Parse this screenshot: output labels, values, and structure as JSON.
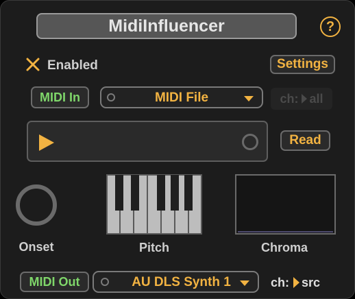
{
  "app": {
    "title": "MidiInfluencer",
    "help_label": "?"
  },
  "enabled": {
    "label": "Enabled"
  },
  "settings_label": "Settings",
  "midi_in": {
    "button_label": "MIDI In",
    "source": "MIDI File",
    "channel_label": "ch:",
    "channel_value": "all"
  },
  "player": {
    "read_label": "Read"
  },
  "analysis": {
    "onset_label": "Onset",
    "pitch_label": "Pitch",
    "chroma_label": "Chroma"
  },
  "midi_out": {
    "button_label": "MIDI Out",
    "destination": "AU DLS Synth 1",
    "channel_label": "ch:",
    "channel_value": "src"
  },
  "colors": {
    "accent": "#f2b342",
    "green": "#7fd66a",
    "panel": "#1c1c1c"
  }
}
